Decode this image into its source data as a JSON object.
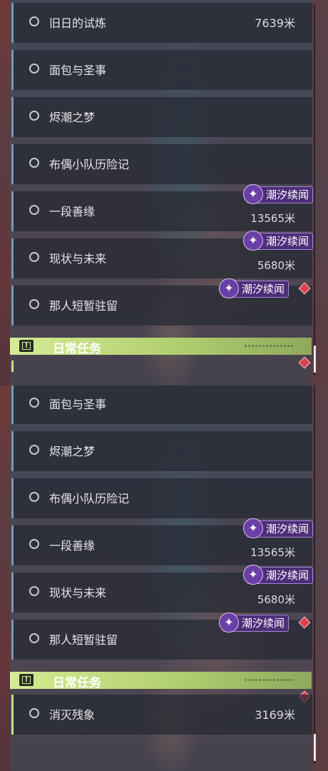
{
  "top_panel": {
    "quests": [
      {
        "name": "旧日的试炼",
        "distance": "7639米"
      },
      {
        "name": "面包与圣事",
        "distance": ""
      },
      {
        "name": "烬潮之梦",
        "distance": ""
      },
      {
        "name": "布偶小队历险记",
        "distance": ""
      },
      {
        "name": "一段善缘",
        "distance": "13565米",
        "tag": "潮汐续闻"
      },
      {
        "name": "现状与未来",
        "distance": "5680米",
        "tag": "潮汐续闻"
      },
      {
        "name": "那人短暂驻留",
        "distance": "",
        "tag": "潮汐续闻"
      }
    ],
    "section_title": "日常任务"
  },
  "bottom_panel": {
    "quests": [
      {
        "name": "面包与圣事",
        "distance": ""
      },
      {
        "name": "烬潮之梦",
        "distance": ""
      },
      {
        "name": "布偶小队历险记",
        "distance": ""
      },
      {
        "name": "一段善缘",
        "distance": "13565米",
        "tag": "潮汐续闻"
      },
      {
        "name": "现状与未来",
        "distance": "5680米",
        "tag": "潮汐续闻"
      },
      {
        "name": "那人短暂驻留",
        "distance": "",
        "tag": "潮汐续闻"
      }
    ],
    "section_title": "日常任务",
    "daily_quests": [
      {
        "name": "消灭残象",
        "distance": "3169米"
      }
    ]
  },
  "icons": {
    "radio": "radio-unselected-icon",
    "tag": "tidal-sparkle-icon",
    "alert": "exclamation-icon",
    "new": "red-diamond-icon"
  },
  "colors": {
    "tag_bg": "#4c2d78",
    "header_green": "#c5de86",
    "new_marker": "#d9434f",
    "row_accent": "#7d97ad"
  }
}
